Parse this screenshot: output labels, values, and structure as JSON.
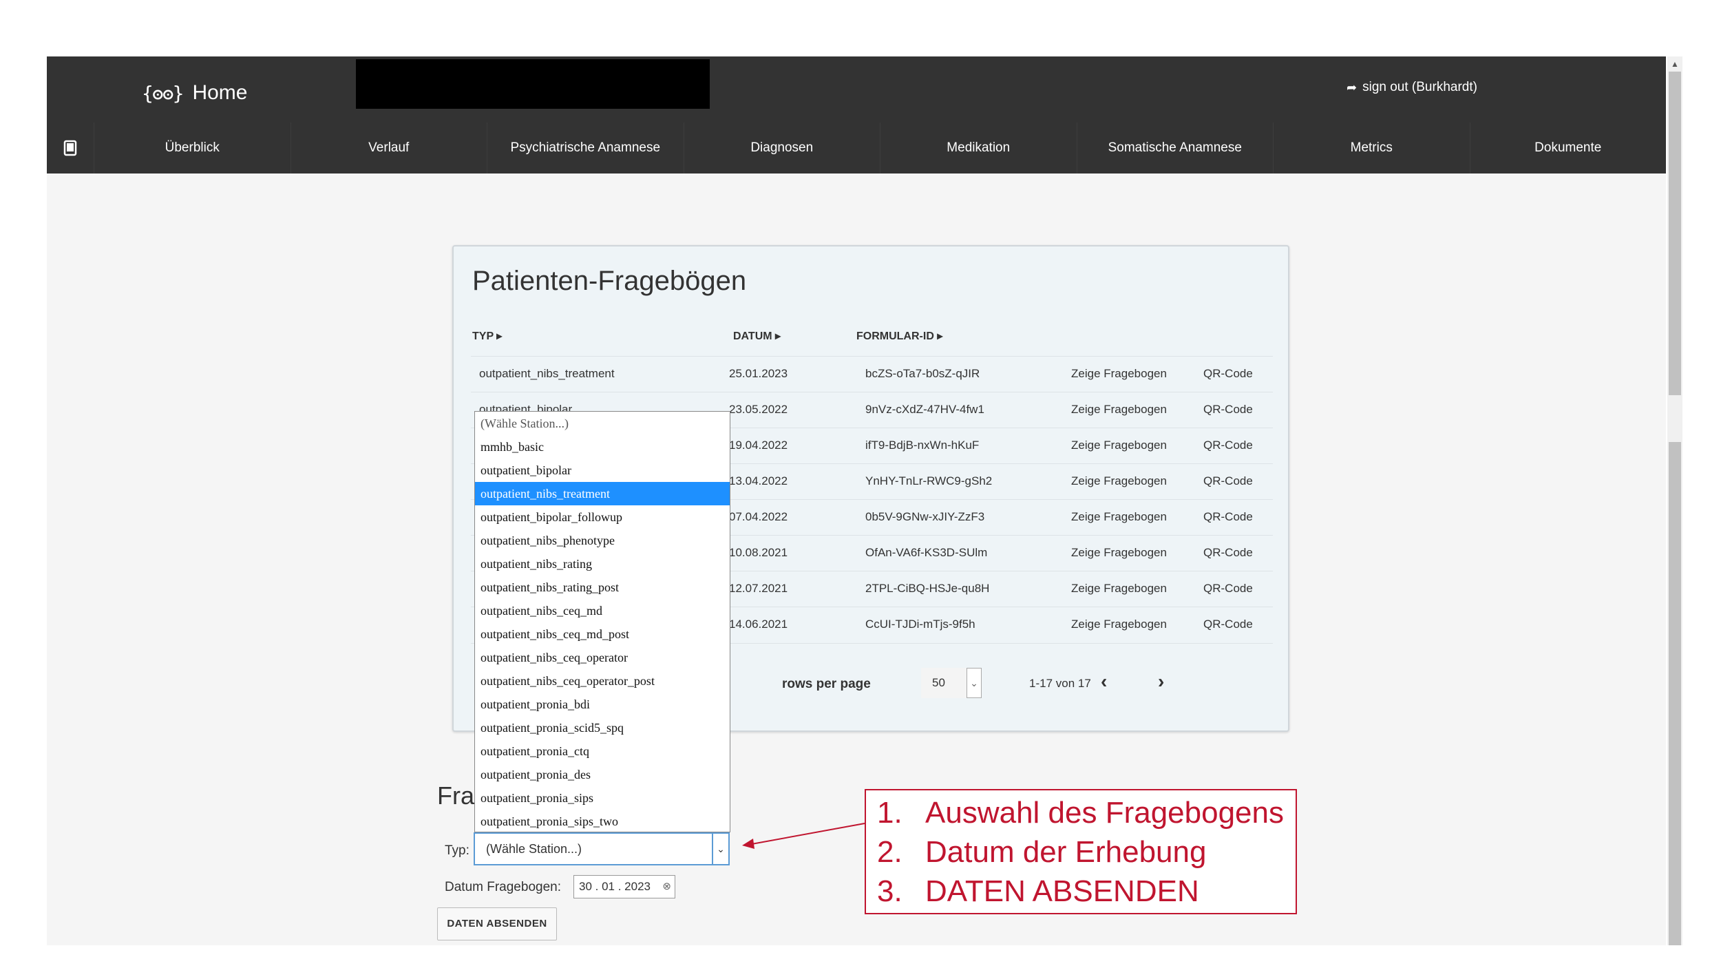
{
  "header": {
    "brand_icon": "{ʘʘ}",
    "brand_label": "Home",
    "signout_icon": "sign-out-icon",
    "signout_label": "sign out (Burkhardt)"
  },
  "nav": {
    "device_icon": "tablet-icon",
    "items": [
      "Überblick",
      "Verlauf",
      "Psychiatrische Anamnese",
      "Diagnosen",
      "Medikation",
      "Somatische Anamnese",
      "Metrics",
      "Dokumente"
    ]
  },
  "table": {
    "title": "Patienten-Fragebögen",
    "columns": [
      "TYP",
      "DATUM",
      "FORMULAR-ID"
    ],
    "rows": [
      {
        "typ": "outpatient_nibs_treatment",
        "datum": "25.01.2023",
        "id": "bcZS-oTa7-b0sZ-qJIR",
        "action": "Zeige Fragebogen",
        "qr": "QR-Code"
      },
      {
        "typ": "outpatient_bipolar",
        "datum": "23.05.2022",
        "id": "9nVz-cXdZ-47HV-4fw1",
        "action": "Zeige Fragebogen",
        "qr": "QR-Code"
      },
      {
        "typ": "",
        "datum": "19.04.2022",
        "id": "ifT9-BdjB-nxWn-hKuF",
        "action": "Zeige Fragebogen",
        "qr": "QR-Code"
      },
      {
        "typ": "",
        "datum": "13.04.2022",
        "id": "YnHY-TnLr-RWC9-gSh2",
        "action": "Zeige Fragebogen",
        "qr": "QR-Code"
      },
      {
        "typ": "",
        "datum": "07.04.2022",
        "id": "0b5V-9GNw-xJIY-ZzF3",
        "action": "Zeige Fragebogen",
        "qr": "QR-Code"
      },
      {
        "typ": "",
        "datum": "10.08.2021",
        "id": "OfAn-VA6f-KS3D-SUlm",
        "action": "Zeige Fragebogen",
        "qr": "QR-Code"
      },
      {
        "typ": "",
        "datum": "12.07.2021",
        "id": "2TPL-CiBQ-HSJe-qu8H",
        "action": "Zeige Fragebogen",
        "qr": "QR-Code"
      },
      {
        "typ": "",
        "datum": "14.06.2021",
        "id": "CcUI-TJDi-mTjs-9f5h",
        "action": "Zeige Fragebogen",
        "qr": "QR-Code"
      }
    ],
    "pagination": {
      "rows_per_page_label": "rows per page",
      "rows_per_page": "50",
      "range": "1-17 von 17"
    }
  },
  "form": {
    "section_title": "Fra",
    "typ_label": "Typ:",
    "typ_value": "(Wähle Station...)",
    "date_label": "Datum Fragebogen:",
    "date_value": "30 . 01 . 2023",
    "submit_label": "DATEN ABSENDEN"
  },
  "dropdown": {
    "options": [
      "(Wähle Station...)",
      "mmhb_basic",
      "outpatient_bipolar",
      "outpatient_nibs_treatment",
      "outpatient_bipolar_followup",
      "outpatient_nibs_phenotype",
      "outpatient_nibs_rating",
      "outpatient_nibs_rating_post",
      "outpatient_nibs_ceq_md",
      "outpatient_nibs_ceq_md_post",
      "outpatient_nibs_ceq_operator",
      "outpatient_nibs_ceq_operator_post",
      "outpatient_pronia_bdi",
      "outpatient_pronia_scid5_spq",
      "outpatient_pronia_ctq",
      "outpatient_pronia_des",
      "outpatient_pronia_sips",
      "outpatient_pronia_sips_two"
    ],
    "selected": "outpatient_nibs_treatment"
  },
  "annotation": {
    "items": [
      {
        "num": "1.",
        "text": "Auswahl des Fragebogens"
      },
      {
        "num": "2.",
        "text": "Datum der Erhebung"
      },
      {
        "num": "3.",
        "text": "DATEN ABSENDEN"
      }
    ],
    "color": "#c0152f"
  },
  "colors": {
    "topbar": "#333333",
    "card_bg": "#eef4f7",
    "selected_option": "#1e90ff"
  }
}
